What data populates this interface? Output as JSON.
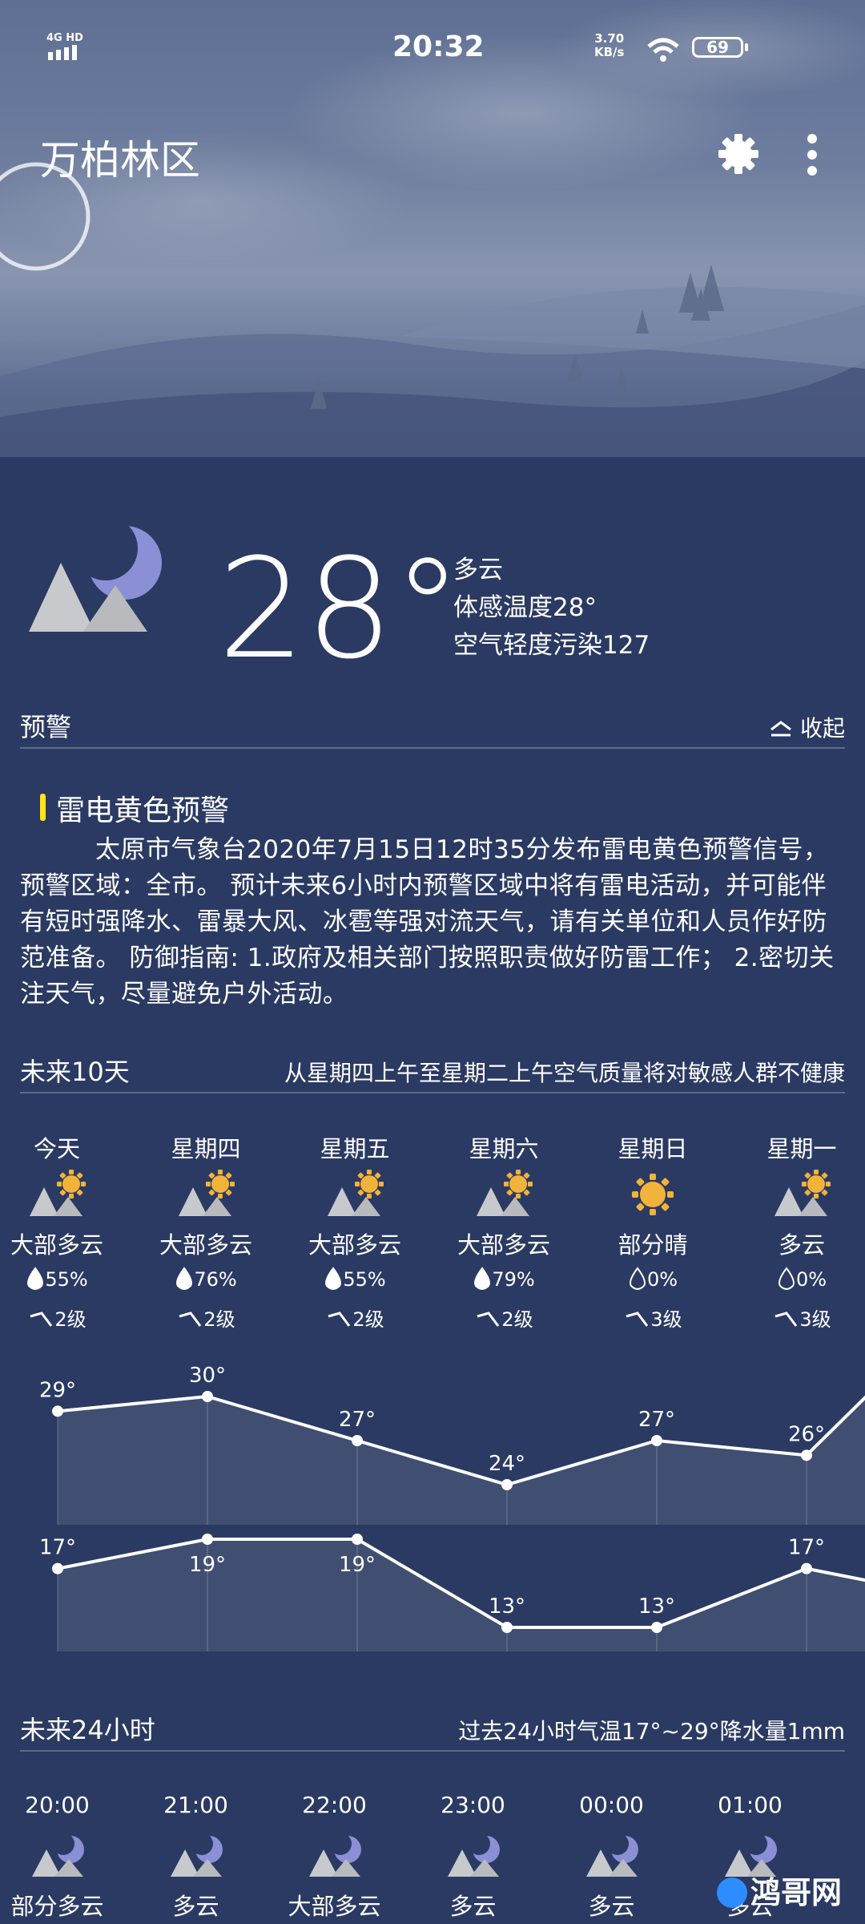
{
  "status": {
    "time": "20:32",
    "signal": "4G HD",
    "net_speed_value": "3.70",
    "net_speed_unit": "KB/s",
    "battery": "69"
  },
  "header": {
    "city": "万柏林区",
    "settings_icon": "gear-icon",
    "menu_icon": "more-vertical-icon"
  },
  "current": {
    "temperature": "28°",
    "condition": "多云",
    "feels_like": "体感温度28°",
    "air_quality": "空气轻度污染127",
    "icon": "partly-cloudy-night-icon"
  },
  "warning_section": {
    "title": "预警",
    "collapse_label": "收起",
    "alert_title": "雷电黄色预警",
    "alert_text": "太原市气象台2020年7月15日12时35分发布雷电黄色预警信号，预警区域：全市。 预计未来6小时内预警区域中将有雷电活动，并可能伴有短时强降水、雷暴大风、冰雹等强对流天气，请有关单位和人员作好防范准备。 防御指南: 1.政府及相关部门按照职责做好防雷工作； 2.密切关注天气，尽量避免户外活动。",
    "accent_color": "#ffe51a"
  },
  "forecast10": {
    "title": "未来10天",
    "notice": "从星期四上午至星期二上午空气质量将对敏感人群不健康",
    "days": [
      {
        "name": "今天",
        "icon": "partly-cloudy-day-icon",
        "condition": "大部多云",
        "rain": "55%",
        "wind": "2级"
      },
      {
        "name": "星期四",
        "icon": "partly-cloudy-day-icon",
        "condition": "大部多云",
        "rain": "76%",
        "wind": "2级"
      },
      {
        "name": "星期五",
        "icon": "partly-cloudy-day-icon",
        "condition": "大部多云",
        "rain": "55%",
        "wind": "2级"
      },
      {
        "name": "星期六",
        "icon": "partly-cloudy-day-icon",
        "condition": "大部多云",
        "rain": "79%",
        "wind": "2级"
      },
      {
        "name": "星期日",
        "icon": "sunny-icon",
        "condition": "部分晴",
        "rain": "0%",
        "wind": "3级"
      },
      {
        "name": "星期一",
        "icon": "partly-cloudy-day-icon",
        "condition": "多云",
        "rain": "0%",
        "wind": "3级"
      }
    ],
    "high_temps": [
      29,
      30,
      27,
      24,
      27,
      26
    ],
    "low_temps": [
      17,
      19,
      19,
      13,
      13,
      17
    ],
    "high_labels": [
      "29°",
      "30°",
      "27°",
      "24°",
      "27°",
      "26°"
    ],
    "low_labels": [
      "17°",
      "19°",
      "19°",
      "13°",
      "13°",
      "17°"
    ]
  },
  "forecast24": {
    "title": "未来24小时",
    "notice": "过去24小时气温17°~29°降水量1mm",
    "hours": [
      {
        "time": "20:00",
        "condition": "部分多云",
        "icon": "partly-cloudy-night-icon"
      },
      {
        "time": "21:00",
        "condition": "多云",
        "icon": "partly-cloudy-night-icon"
      },
      {
        "time": "22:00",
        "condition": "大部多云",
        "icon": "partly-cloudy-night-icon"
      },
      {
        "time": "23:00",
        "condition": "多云",
        "icon": "partly-cloudy-night-icon"
      },
      {
        "time": "00:00",
        "condition": "多云",
        "icon": "partly-cloudy-night-icon"
      },
      {
        "time": "01:00",
        "condition": "多云",
        "icon": "partly-cloudy-night-icon"
      }
    ]
  },
  "watermark": "鸿哥网"
}
